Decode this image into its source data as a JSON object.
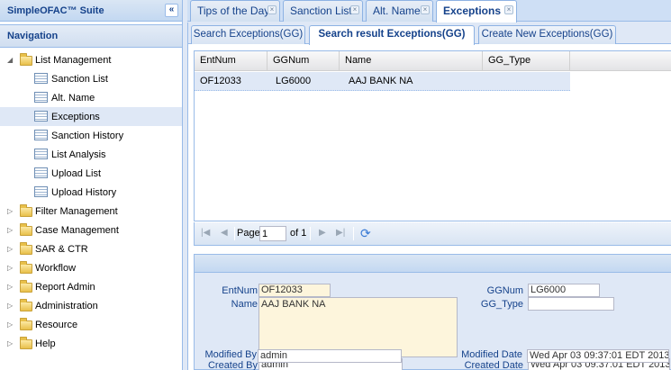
{
  "app": {
    "title": "SimpleOFAC™ Suite",
    "collapse_icon": "double-chevron-left-icon"
  },
  "navigation": {
    "title": "Navigation",
    "tree": [
      {
        "label": "List Management",
        "expanded": true,
        "children": [
          {
            "label": "Sanction List"
          },
          {
            "label": "Alt. Name"
          },
          {
            "label": "Exceptions",
            "selected": true
          },
          {
            "label": "Sanction History"
          },
          {
            "label": "List Analysis"
          },
          {
            "label": "Upload List"
          },
          {
            "label": "Upload History"
          }
        ]
      },
      {
        "label": "Filter Management"
      },
      {
        "label": "Case Management"
      },
      {
        "label": "SAR & CTR"
      },
      {
        "label": "Workflow"
      },
      {
        "label": "Report Admin"
      },
      {
        "label": "Administration"
      },
      {
        "label": "Resource"
      },
      {
        "label": "Help"
      }
    ]
  },
  "tabs": [
    {
      "label": "Tips of the Day"
    },
    {
      "label": "Sanction List"
    },
    {
      "label": "Alt. Name"
    },
    {
      "label": "Exceptions",
      "active": true
    }
  ],
  "subtabs": [
    {
      "label": "Search Exceptions(GG)"
    },
    {
      "label": "Search result Exceptions(GG)",
      "active": true
    },
    {
      "label": "Create New Exceptions(GG)"
    }
  ],
  "grid": {
    "columns": [
      "EntNum",
      "GGNum",
      "Name",
      "GG_Type"
    ],
    "rows": [
      {
        "EntNum": "OF12033",
        "GGNum": "LG6000",
        "Name": "AAJ BANK NA",
        "GG_Type": ""
      }
    ]
  },
  "pager": {
    "page_label": "Page",
    "page_value": "1",
    "of_label": "of 1"
  },
  "detail": {
    "entnum_label": "EntNum",
    "entnum_value": "OF12033",
    "name_label": "Name",
    "name_value": "AAJ BANK NA",
    "ggnum_label": "GGNum",
    "ggnum_value": "LG6000",
    "ggtype_label": "GG_Type",
    "ggtype_value": "",
    "created_by_label": "Created By",
    "created_by_value": "admin",
    "modified_by_label": "Modified By",
    "modified_by_value": "admin",
    "created_date_label": "Created Date",
    "created_date_value": "Wed Apr 03 09:37:01 EDT 2013",
    "modified_date_label": "Modified Date",
    "modified_date_value": "Wed Apr 03 09:37:01 EDT 2013"
  }
}
